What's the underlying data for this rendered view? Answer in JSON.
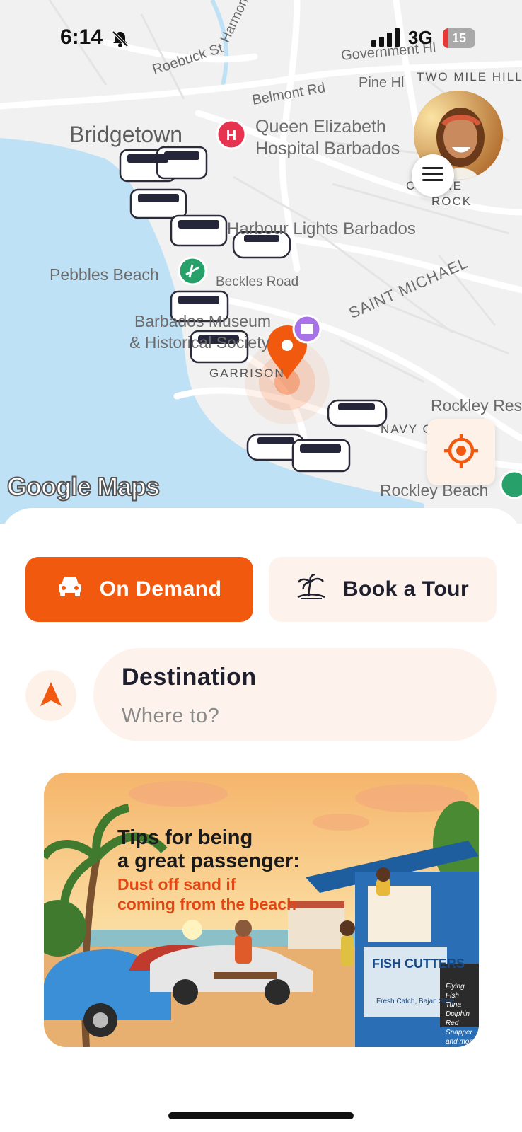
{
  "status_bar": {
    "time": "6:14",
    "network": "3G",
    "battery": "15",
    "battery_level": 0.15
  },
  "map": {
    "labels": {
      "roebuck": "Roebuck St",
      "harmony": "Harmon",
      "government": "Government Hl",
      "pine": "Pine Hl",
      "two_mile": "TWO MILE HILL",
      "belmont": "Belmont Rd",
      "bridgetown": "Bridgetown",
      "hospital_1": "Queen Elizabeth",
      "hospital_2": "Hospital Barbados",
      "more_rock_1": "C    MORE",
      "more_rock_2": "ROCK",
      "harbour": "Harbour Lights Barbados",
      "pebbles": "Pebbles Beach",
      "beckles": "Beckles Road",
      "museum_1": "Barbados Museum",
      "museum_2": "& Historical Society",
      "saint_michael": "SAINT MICHAEL",
      "garrison": "GARRISON",
      "rockley_res": "Rockley Res",
      "navy": "NAVY G",
      "rockley_beach": "Rockley Beach"
    },
    "google_logo": "Google Maps",
    "menu_icon": "hamburger-icon",
    "locate_icon": "crosshair-icon"
  },
  "modes": {
    "on_demand": {
      "label": "On Demand",
      "icon": "car-icon"
    },
    "tour": {
      "label": "Book a Tour",
      "icon": "palm-tree-icon"
    }
  },
  "destination": {
    "title": "Destination",
    "placeholder": "Where to?",
    "icon": "navigation-arrow-icon"
  },
  "promo": {
    "heading_1": "Tips for being",
    "heading_2": "a great passenger:",
    "sub_1": "Dust off sand if",
    "sub_2": "coming from the beach",
    "shop_sign": "FISH CUTTERS",
    "shop_sub": "Fresh Catch, Bajan Style",
    "board": [
      "Flying Fish",
      "Tuna",
      "Dolphin",
      "Red Snapper",
      "and more!"
    ]
  },
  "colors": {
    "accent": "#f1590f",
    "light_accent": "#fdf3ec",
    "text_dark": "#1f1f2e"
  }
}
